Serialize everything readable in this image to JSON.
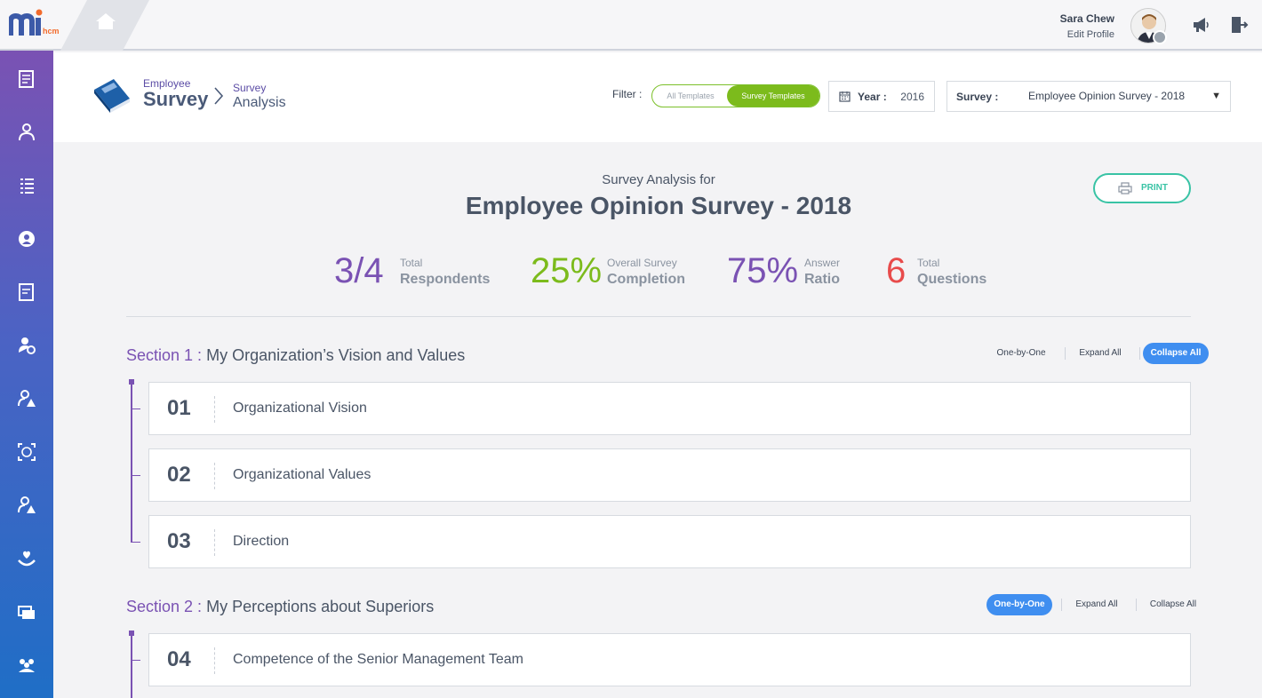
{
  "app": {
    "logo_text": "mi",
    "logo_sub": "hcm"
  },
  "user": {
    "name": "Sara Chew",
    "edit_profile": "Edit Profile"
  },
  "breadcrumb": {
    "module_small": "Employee",
    "module_big": "Survey",
    "page_small": "Survey",
    "page_big": "Analysis"
  },
  "filter": {
    "label": "Filter :",
    "options": [
      "All Templates",
      "Survey Templates"
    ],
    "selected": "Survey Templates"
  },
  "year": {
    "label": "Year :",
    "value": "2016"
  },
  "survey_select": {
    "label": "Survey :",
    "value": "Employee Opinion Survey - 2018"
  },
  "analysis": {
    "subtitle": "Survey Analysis for",
    "title": "Employee Opinion Survey - 2018",
    "print_label": "PRINT"
  },
  "stats": [
    {
      "value": "3/4",
      "small": "Total",
      "big": "Respondents",
      "color": "#7a52b3"
    },
    {
      "value": "25%",
      "small": "Overall Survey",
      "big": "Completion",
      "color": "#7cbb1c"
    },
    {
      "value": "75%",
      "small": "Answer",
      "big": "Ratio",
      "color": "#7a52b3"
    },
    {
      "value": "6",
      "small": "Total",
      "big": "Questions",
      "color": "#e84b4b"
    }
  ],
  "view_controls": {
    "one_by_one": "One-by-One",
    "expand_all": "Expand All",
    "collapse_all": "Collapse All"
  },
  "sections": [
    {
      "number": "Section 1 :",
      "name": "My Organization’s Vision and Values",
      "active_control": "collapse_all",
      "questions": [
        {
          "num": "01",
          "text": "Organizational Vision"
        },
        {
          "num": "02",
          "text": "Organizational Values"
        },
        {
          "num": "03",
          "text": "Direction"
        }
      ]
    },
    {
      "number": "Section 2 :",
      "name": "My Perceptions about Superiors",
      "active_control": "one_by_one",
      "questions": [
        {
          "num": "04",
          "text": "Competence of the Senior Management Team"
        }
      ]
    }
  ],
  "sidebar": {
    "icons": [
      "document-icon",
      "manager-icon",
      "list-icon",
      "profile-icon",
      "notes-icon",
      "user-settings-icon",
      "user-alert-icon",
      "fingerprint-icon",
      "user-warning-icon",
      "care-icon",
      "payslip-icon",
      "team-icon"
    ]
  },
  "colors": {
    "accent_purple": "#7a52b3",
    "accent_green": "#7cbb1c",
    "accent_blue": "#3f8ef0",
    "accent_teal": "#39c3a5",
    "accent_red": "#e84b4b"
  }
}
